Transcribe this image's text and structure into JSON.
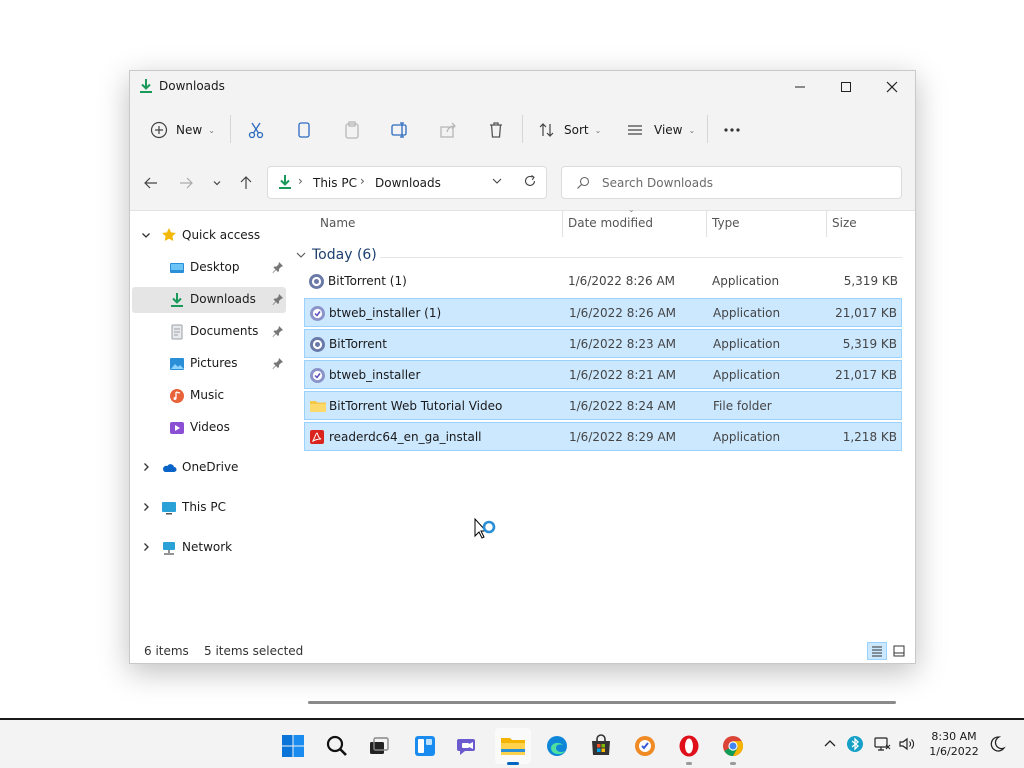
{
  "window": {
    "title": "Downloads",
    "controls": [
      "minimize",
      "maximize",
      "close"
    ]
  },
  "command_bar": {
    "new_label": "New",
    "sort_label": "Sort",
    "view_label": "View",
    "icons": [
      "cut-icon",
      "copy-icon",
      "paste-icon",
      "rename-icon",
      "share-icon",
      "delete-icon",
      "more-icon"
    ]
  },
  "address_bar": {
    "breadcrumbs": [
      "This PC",
      "Downloads"
    ]
  },
  "search": {
    "placeholder": "Search Downloads"
  },
  "sidebar": {
    "quick_access": "Quick access",
    "items": [
      {
        "label": "Desktop",
        "pinned": true
      },
      {
        "label": "Downloads",
        "pinned": true,
        "selected": true
      },
      {
        "label": "Documents",
        "pinned": true
      },
      {
        "label": "Pictures",
        "pinned": true
      },
      {
        "label": "Music",
        "pinned": false
      },
      {
        "label": "Videos",
        "pinned": false
      }
    ],
    "onedrive": "OneDrive",
    "this_pc": "This PC",
    "network": "Network"
  },
  "columns": {
    "name": "Name",
    "date": "Date modified",
    "type": "Type",
    "size": "Size"
  },
  "group": {
    "label": "Today (6)"
  },
  "files": [
    {
      "name": "BitTorrent (1)",
      "date": "1/6/2022 8:26 AM",
      "type": "Application",
      "size": "5,319 KB",
      "icon": "bittorrent-icon",
      "selected": false
    },
    {
      "name": "btweb_installer (1)",
      "date": "1/6/2022 8:26 AM",
      "type": "Application",
      "size": "21,017 KB",
      "icon": "btweb-icon",
      "selected": true
    },
    {
      "name": "BitTorrent",
      "date": "1/6/2022 8:23 AM",
      "type": "Application",
      "size": "5,319 KB",
      "icon": "bittorrent-icon",
      "selected": true
    },
    {
      "name": "btweb_installer",
      "date": "1/6/2022 8:21 AM",
      "type": "Application",
      "size": "21,017 KB",
      "icon": "btweb-icon",
      "selected": true
    },
    {
      "name": "BitTorrent Web Tutorial Video",
      "date": "1/6/2022 8:24 AM",
      "type": "File folder",
      "size": "",
      "icon": "folder-icon",
      "selected": true
    },
    {
      "name": "readerdc64_en_ga_install",
      "date": "1/6/2022 8:29 AM",
      "type": "Application",
      "size": "1,218 KB",
      "icon": "adobe-reader-icon",
      "selected": true
    }
  ],
  "status": {
    "items": "6 items",
    "selected": "5 items selected"
  },
  "taskbar": {
    "apps": [
      "start-icon",
      "search-icon",
      "task-view-icon",
      "widgets-icon",
      "chat-icon",
      "file-explorer-icon",
      "edge-icon",
      "store-icon",
      "avast-browser-icon",
      "opera-icon",
      "chrome-icon"
    ],
    "time": "8:30 AM",
    "date": "1/6/2022"
  },
  "colors": {
    "selection": "#cce8ff",
    "selection_border": "#99d1ff",
    "accent": "#0067c0"
  }
}
